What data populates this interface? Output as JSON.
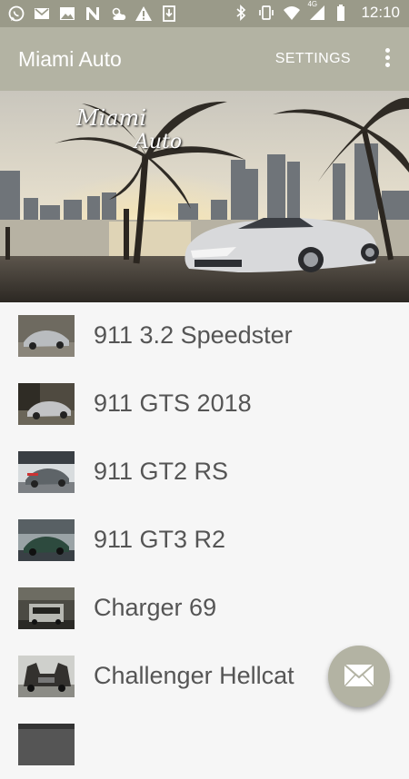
{
  "status_bar": {
    "network": "4G",
    "time": "12:10",
    "left_icons": [
      "whatsapp-icon",
      "gmail-icon",
      "photos-icon",
      "n-app-icon",
      "weather-icon",
      "warning-icon",
      "download-icon"
    ],
    "right_icons": [
      "bluetooth-icon",
      "vibrate-icon",
      "wifi-icon",
      "signal-icon",
      "battery-icon"
    ]
  },
  "app_bar": {
    "title": "Miami Auto",
    "settings_label": "SETTINGS",
    "overflow_icon": "more-vert-icon"
  },
  "hero": {
    "line1": "Miami",
    "line2": "Auto"
  },
  "cars": [
    {
      "name": "911 3.2 Speedster",
      "thumb_color": "#b9bcbf"
    },
    {
      "name": "911 GTS 2018",
      "thumb_color": "#8f8f86"
    },
    {
      "name": "911 GT2 RS",
      "thumb_color": "#9aa0a4"
    },
    {
      "name": "911 GT3 R2",
      "thumb_color": "#2d4a3e"
    },
    {
      "name": "Charger 69",
      "thumb_color": "#3d3a34"
    },
    {
      "name": "Challenger Hellcat",
      "thumb_color": "#33312e"
    },
    {
      "name": "",
      "thumb_color": "#444444"
    }
  ],
  "fab": {
    "icon": "mail-icon"
  },
  "colors": {
    "status_bar": "#9a9a89",
    "app_bar": "#b3b3a3",
    "list_bg": "#f6f6f6",
    "label_text": "#555555"
  }
}
